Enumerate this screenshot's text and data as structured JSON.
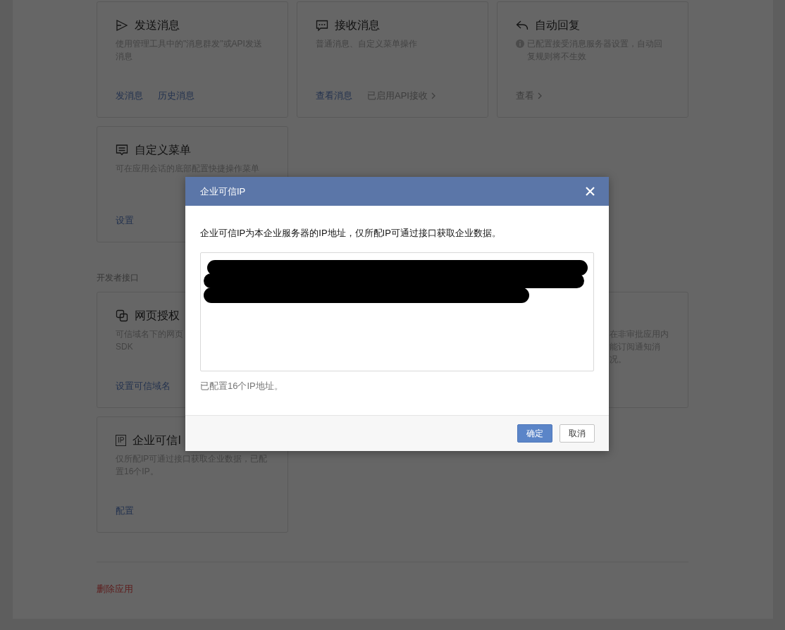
{
  "message_section": {
    "cards": [
      {
        "kind": "send",
        "title": "发送消息",
        "description": "使用管理工具中的\"消息群发\"或API发送消息",
        "links": [
          {
            "label": "发消息",
            "kind": "primary"
          },
          {
            "label": "历史消息",
            "kind": "primary"
          }
        ]
      },
      {
        "kind": "receive",
        "title": "接收消息",
        "description": "普通消息、自定义菜单操作",
        "links": [
          {
            "label": "查看消息",
            "kind": "primary"
          },
          {
            "label": "已启用API接收",
            "kind": "nav"
          }
        ]
      },
      {
        "kind": "reply",
        "title": "自动回复",
        "notice": true,
        "description": "已配置接受消息服务器设置，自动回复规则将不生效",
        "links": [
          {
            "label": "查看",
            "kind": "nav"
          }
        ]
      },
      {
        "kind": "menu",
        "title": "自定义菜单",
        "description": "可在应用会话的底部配置快捷操作菜单",
        "links": [
          {
            "label": "设置",
            "kind": "primary"
          }
        ]
      }
    ]
  },
  "developer_section": {
    "label": "开发者接口",
    "cards": [
      {
        "kind": "web-auth",
        "title": "网页授权",
        "description_lines": [
          "可信域名下的网页",
          "SDK"
        ],
        "links": [
          {
            "label": "设置可信域名",
            "kind": "primary"
          }
        ]
      },
      {
        "covered_left": true,
        "description_lines": [
          "在非审批应用内",
          "能订阅通知消",
          "况。"
        ]
      },
      {
        "kind": "ip",
        "icon_text": "IP",
        "title": "企业可信I",
        "description": "仅所配IP可通过接口获取企业数据，已配置16个IP。",
        "links": [
          {
            "label": "配置",
            "kind": "primary"
          }
        ]
      }
    ]
  },
  "footer": {
    "delete_link": "删除应用"
  },
  "modal": {
    "title": "企业可信IP",
    "description": "企业可信IP为本企业服务器的IP地址，仅所配IP可通过接口获取企业数据。",
    "ip_field": {
      "redacted": true
    },
    "count_text": "已配置16个IP地址。",
    "buttons": [
      {
        "label": "确定",
        "kind": "primary"
      },
      {
        "label": "取消",
        "kind": "default"
      }
    ]
  }
}
